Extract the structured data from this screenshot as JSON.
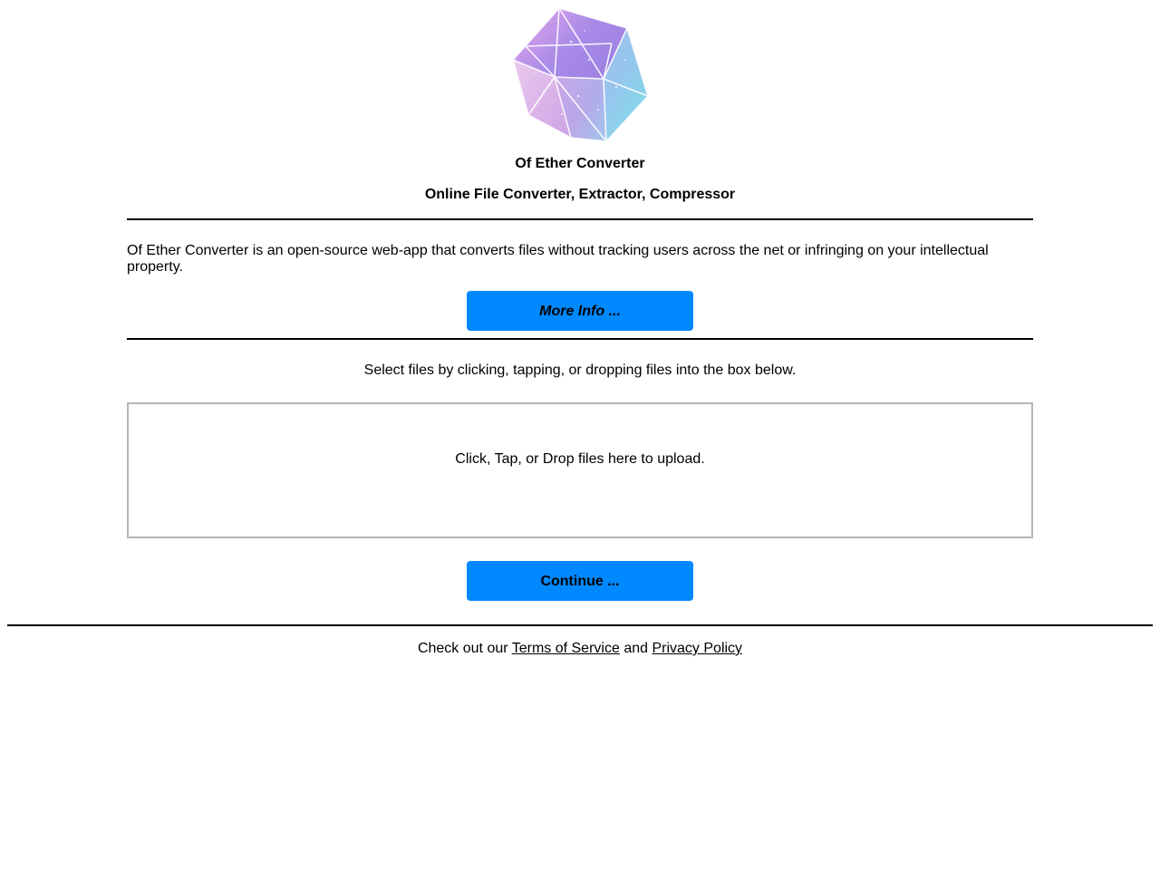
{
  "header": {
    "logo_icon": "icosahedron-crystal-logo",
    "title": "Of Ether Converter",
    "subtitle": "Online File Converter, Extractor, Compressor"
  },
  "intro": {
    "text": "Of Ether Converter is an open-source web-app that converts files without tracking users across the net or infringing on your intellectual property.",
    "more_info_label": "More Info ..."
  },
  "upload": {
    "instructions": "Select files by clicking, tapping, or dropping files into the box below.",
    "dropzone_label": "Click, Tap, or Drop files here to upload.",
    "continue_label": "Continue ..."
  },
  "footer": {
    "prefix": "Check out our",
    "terms_label": "Terms of Service",
    "conjunction": "and",
    "privacy_label": "Privacy Policy"
  },
  "colors": {
    "button_bg": "#0088ff",
    "dropzone_border": "#b5b5b5",
    "rule": "#000000"
  }
}
